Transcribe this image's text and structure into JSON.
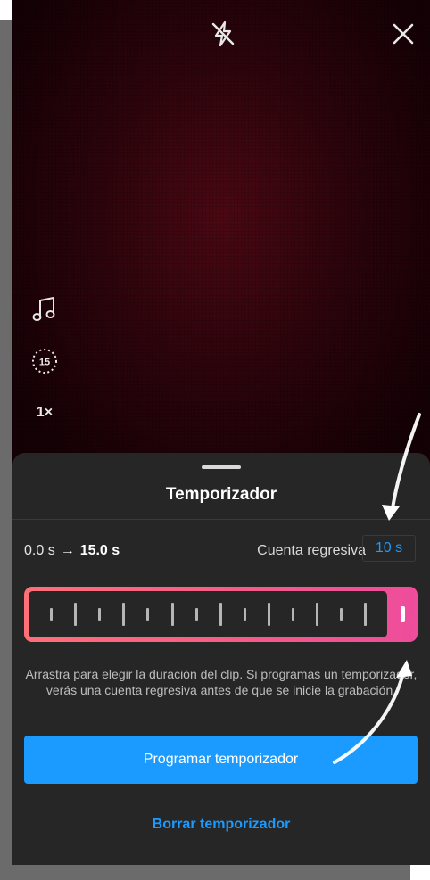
{
  "camera": {
    "flash_icon": "flash-off-icon",
    "close_icon": "close-icon",
    "tools": [
      {
        "name": "music-icon"
      },
      {
        "name": "timer-15-icon",
        "label": "15"
      },
      {
        "name": "speed-control",
        "label": "1×"
      }
    ]
  },
  "timer_sheet": {
    "title": "Temporizador",
    "range_start": "0.0 s",
    "range_end": "15.0 s",
    "countdown_label": "Cuenta regresiva",
    "countdown_value": "10 s",
    "helper_text": "Arrastra para elegir la duración del clip. Si programas un temporizador, verás una cuenta regresiva antes de que se inicie la grabación.",
    "primary_button": "Programar temporizador",
    "secondary_button": "Borrar temporizador",
    "trim_selected_fraction": 1.0
  },
  "colors": {
    "accent": "#1b9bff",
    "trim_gradient_start": "#ff6f78",
    "trim_gradient_end": "#ee4c9c",
    "sheet_bg": "#262626"
  }
}
